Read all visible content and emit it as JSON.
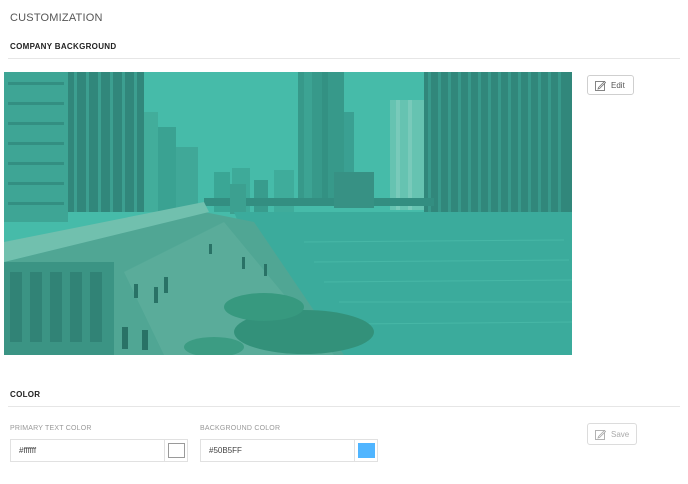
{
  "page": {
    "title": "CUSTOMIZATION"
  },
  "company_background": {
    "section_title": "COMPANY BACKGROUND",
    "edit_label": "Edit",
    "edit_icon": "edit-icon",
    "overlay_color": "#3cb4a0"
  },
  "color": {
    "section_title": "COLOR",
    "primary_text": {
      "label": "PRIMARY TEXT COLOR",
      "value": "#ffffff",
      "swatch": "#ffffff"
    },
    "background": {
      "label": "BACKGROUND COLOR",
      "value": "#50B5FF",
      "swatch": "#50B5FF"
    },
    "save_label": "Save",
    "save_icon": "edit-icon"
  }
}
